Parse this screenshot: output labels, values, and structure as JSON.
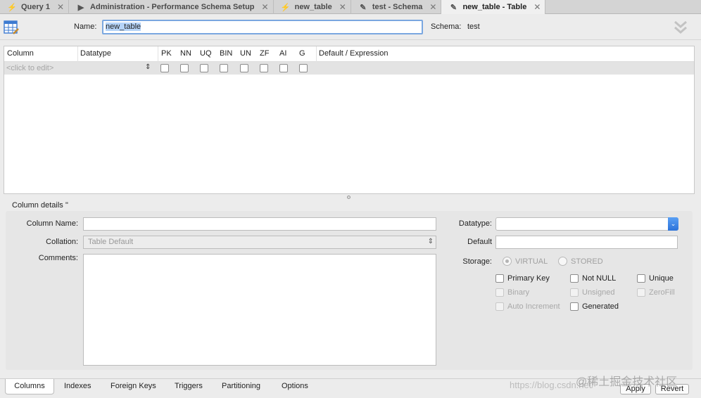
{
  "tabs": [
    {
      "icon": "⚡",
      "label": "Query 1",
      "close": "✕",
      "active": false
    },
    {
      "icon": "▶",
      "label": "Administration - Performance Schema Setup",
      "close": "✕",
      "active": false
    },
    {
      "icon": "⚡",
      "label": "new_table",
      "close": "✕",
      "active": false
    },
    {
      "icon": "✎",
      "label": "test - Schema",
      "close": "✕",
      "active": false
    },
    {
      "icon": "✎",
      "label": "new_table - Table",
      "close": "✕",
      "active": true
    }
  ],
  "header": {
    "name_label": "Name:",
    "name_value": "new_table",
    "schema_label": "Schema:",
    "schema_value": "test"
  },
  "grid": {
    "columns": [
      "Column",
      "Datatype",
      "PK",
      "NN",
      "UQ",
      "BIN",
      "UN",
      "ZF",
      "AI",
      "G",
      "Default / Expression"
    ],
    "placeholder": "<click to edit>"
  },
  "details": {
    "title": "Column details ''",
    "column_name_label": "Column Name:",
    "collation_label": "Collation:",
    "collation_value": "Table Default",
    "comments_label": "Comments:",
    "datatype_label": "Datatype:",
    "default_label": "Default",
    "storage_label": "Storage:",
    "storage_virtual": "VIRTUAL",
    "storage_stored": "STORED",
    "checks": {
      "primary_key": "Primary Key",
      "not_null": "Not NULL",
      "unique": "Unique",
      "binary": "Binary",
      "unsigned": "Unsigned",
      "zerofill": "ZeroFill",
      "auto_increment": "Auto Increment",
      "generated": "Generated"
    }
  },
  "bottom": {
    "tabs": [
      "Columns",
      "Indexes",
      "Foreign Keys",
      "Triggers",
      "Partitioning",
      "Options"
    ],
    "apply": "Apply",
    "revert": "Revert",
    "watermark_url": "https://blog.csdn.net/",
    "watermark_text": "@稀土掘金技术社区"
  },
  "colors": {
    "accent": "#2c72d9",
    "focus_ring": "#7aa7e0",
    "selection": "#b5d3f7"
  }
}
